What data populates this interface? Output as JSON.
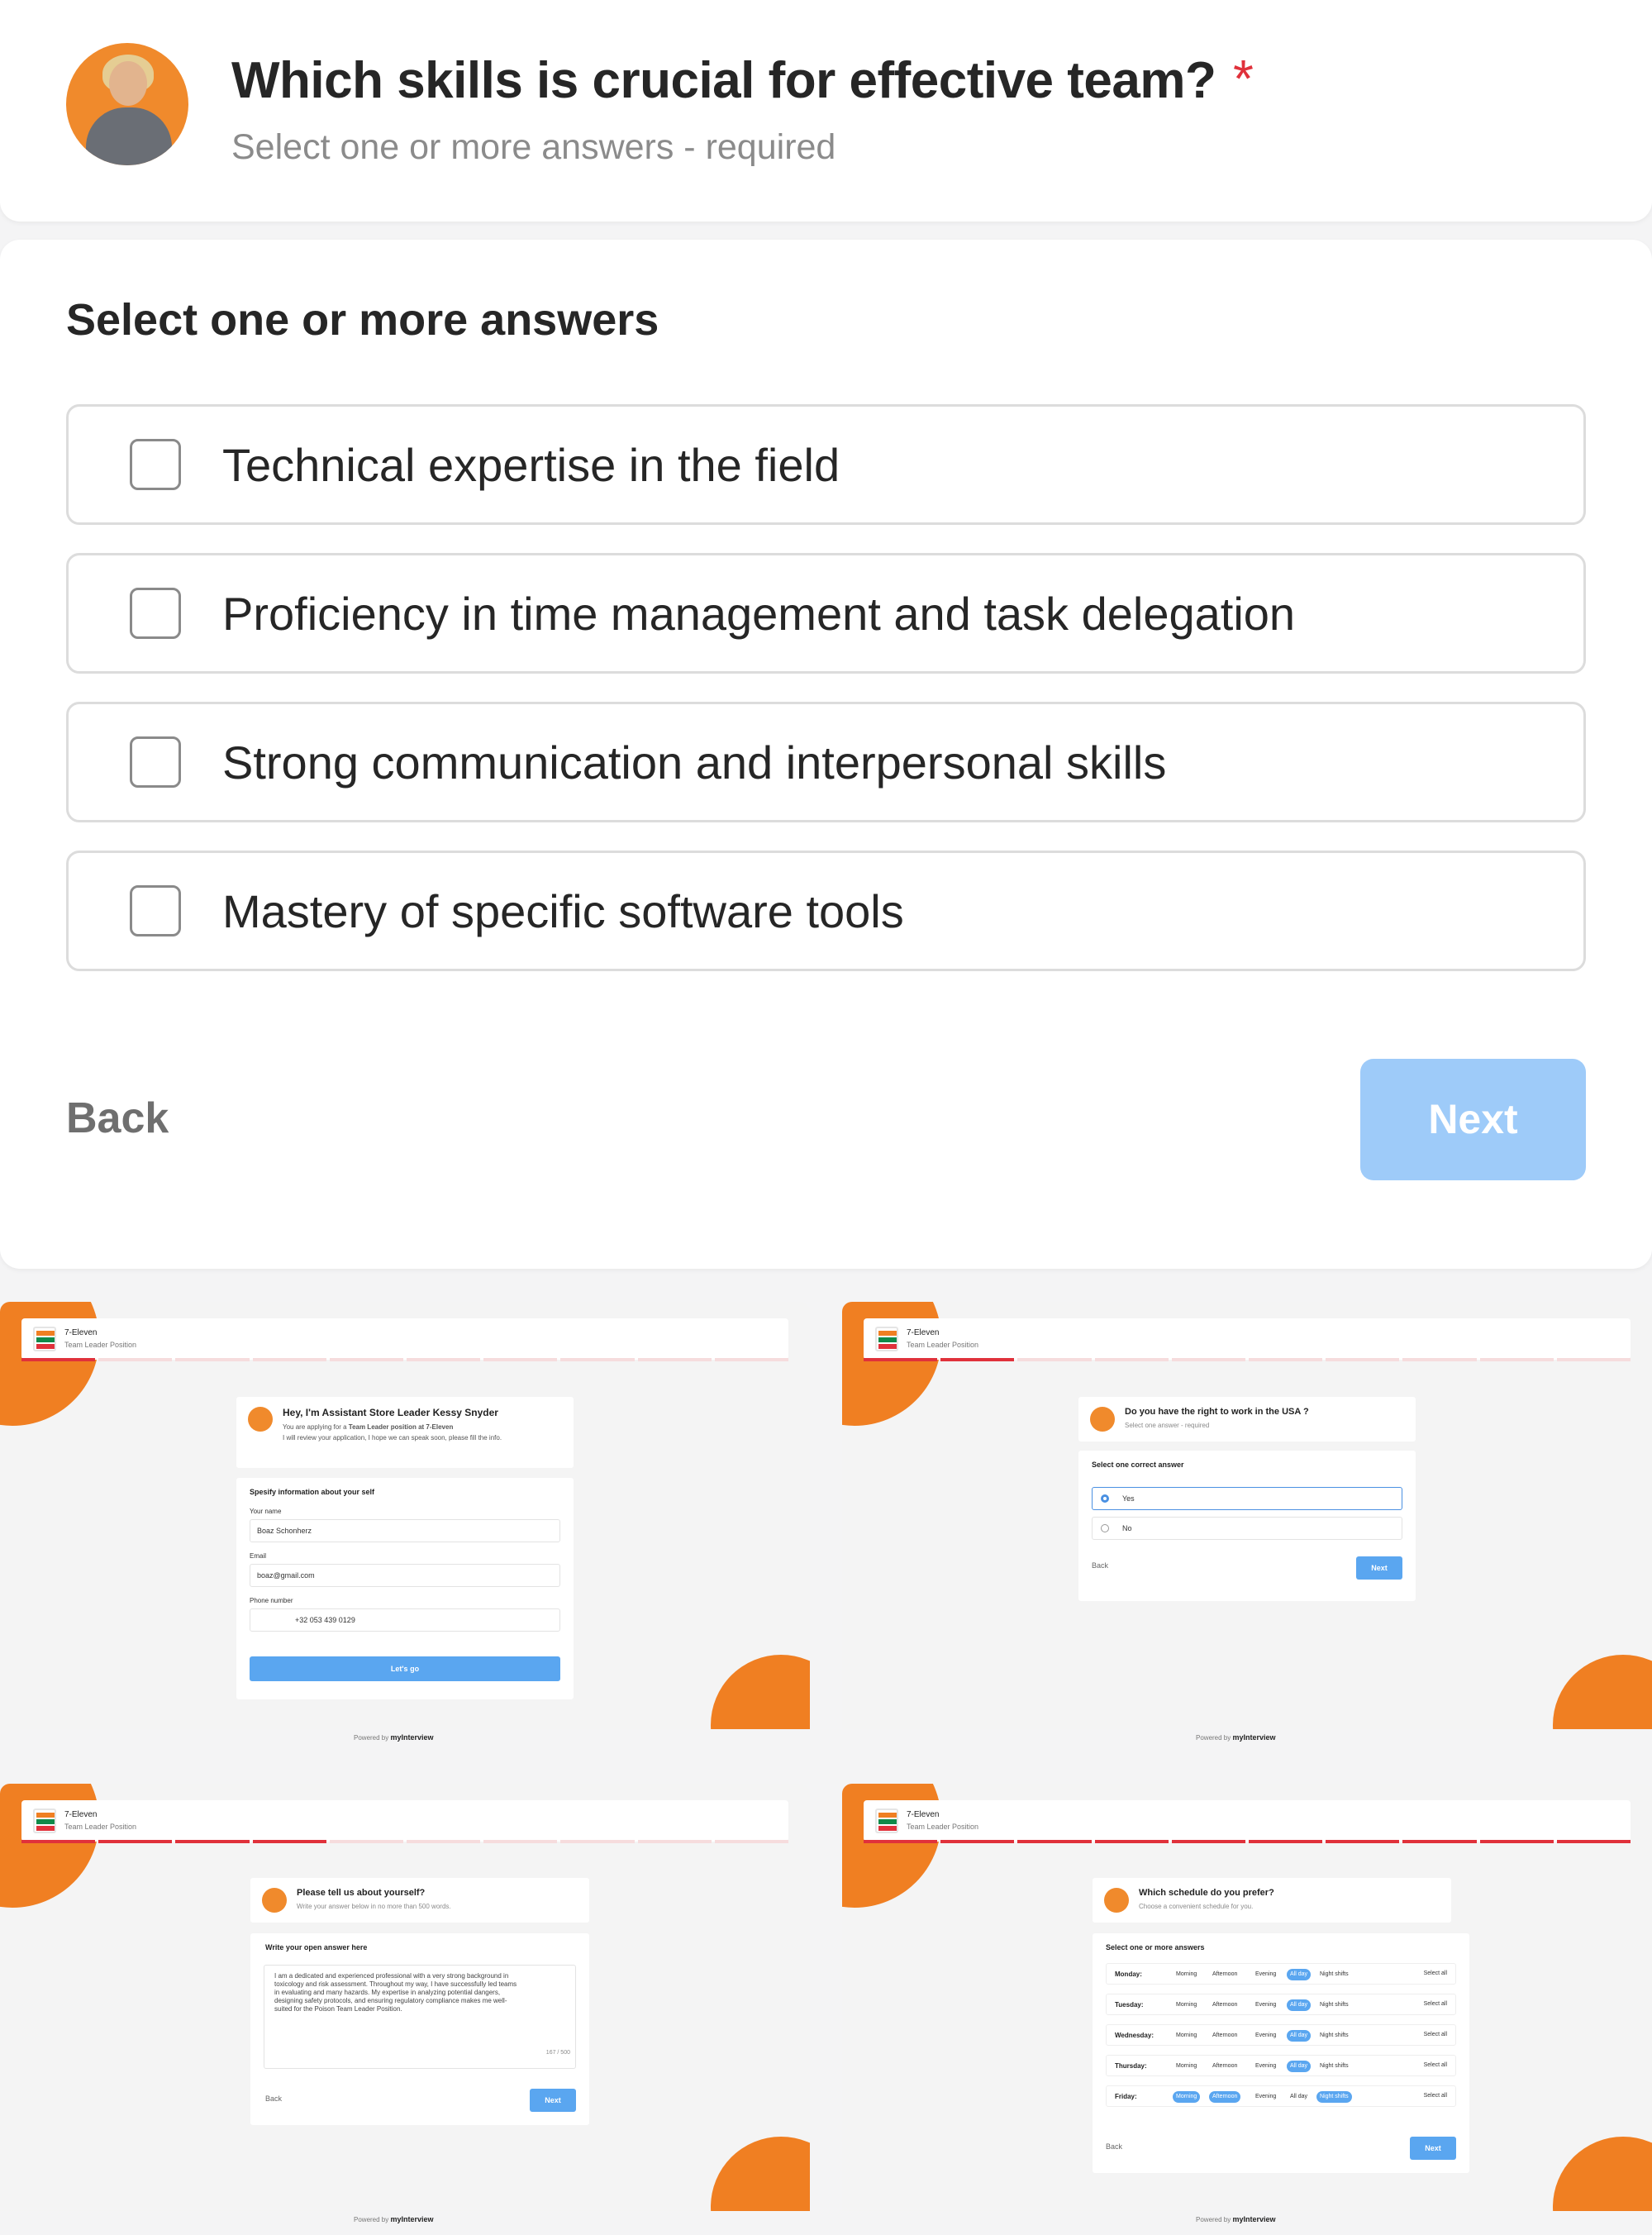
{
  "question": {
    "title": "Which skills is crucial for effective team?",
    "required_mark": "*",
    "subtitle": "Select one or more answers - required"
  },
  "answers": {
    "heading": "Select one or more answers",
    "options": [
      "Technical expertise in the field",
      "Proficiency in time management and task delegation",
      "Strong communication and interpersonal skills",
      "Mastery of specific software tools"
    ]
  },
  "nav": {
    "back": "Back",
    "next": "Next"
  },
  "colors": {
    "accent": "#f07f22",
    "next_disabled": "#9ecbf9",
    "required": "#e0313b"
  },
  "thumbnails": {
    "brand": "7-Eleven",
    "position": "Team Leader Position",
    "powered_by": "Powered by",
    "powered_logo": "myInterview",
    "a": {
      "title": "Hey, I'm Assistant Store Leader Kessy Snyder",
      "line1_pre": "You are applying for a",
      "line1_bold": "Team Leader position at 7-Eleven",
      "line2": "I will review your application, I hope we can speak soon, please fill the info.",
      "section": "Spesify information about your self",
      "name_label": "Your name",
      "name_value": "Boaz Schonherz",
      "email_label": "Email",
      "email_value": "boaz@gmail.com",
      "phone_label": "Phone number",
      "phone_value": "+32 053 439 0129",
      "button": "Let's go"
    },
    "b": {
      "title": "Do you have the right to work in the USA ?",
      "subtitle": "Select one answer - required",
      "section": "Select one correct answer",
      "options": [
        "Yes",
        "No"
      ],
      "back": "Back",
      "next": "Next"
    },
    "c": {
      "title": "Please tell us about yourself?",
      "subtitle": "Write your answer below in no more than 500 words.",
      "section": "Write your open answer here",
      "answer": "I am a dedicated and experienced professional with a very strong background in toxicology and risk assessment. Throughout my way, I have successfully led teams in evaluating and many hazards. My expertise in analyzing potential dangers, designing safety protocols, and ensuring regulatory compliance makes me well-suited for the Poison Team Leader Position.",
      "counter": "167 / 500",
      "back": "Back",
      "next": "Next"
    },
    "d": {
      "title": "Which schedule do you prefer?",
      "subtitle": "Choose a convenient schedule for you.",
      "section": "Select one or more answers",
      "slots": [
        "Morning",
        "Afternoon",
        "Evening",
        "All day",
        "Night shifts"
      ],
      "select_all": "Select all",
      "days": [
        {
          "day": "Monday:",
          "selected": [
            "All day"
          ]
        },
        {
          "day": "Tuesday:",
          "selected": [
            "All day"
          ]
        },
        {
          "day": "Wednesday:",
          "selected": [
            "All day"
          ]
        },
        {
          "day": "Thursday:",
          "selected": [
            "All day"
          ]
        },
        {
          "day": "Friday:",
          "selected": [
            "Morning",
            "Afternoon",
            "Night shifts"
          ]
        }
      ],
      "back": "Back",
      "next": "Next"
    }
  }
}
